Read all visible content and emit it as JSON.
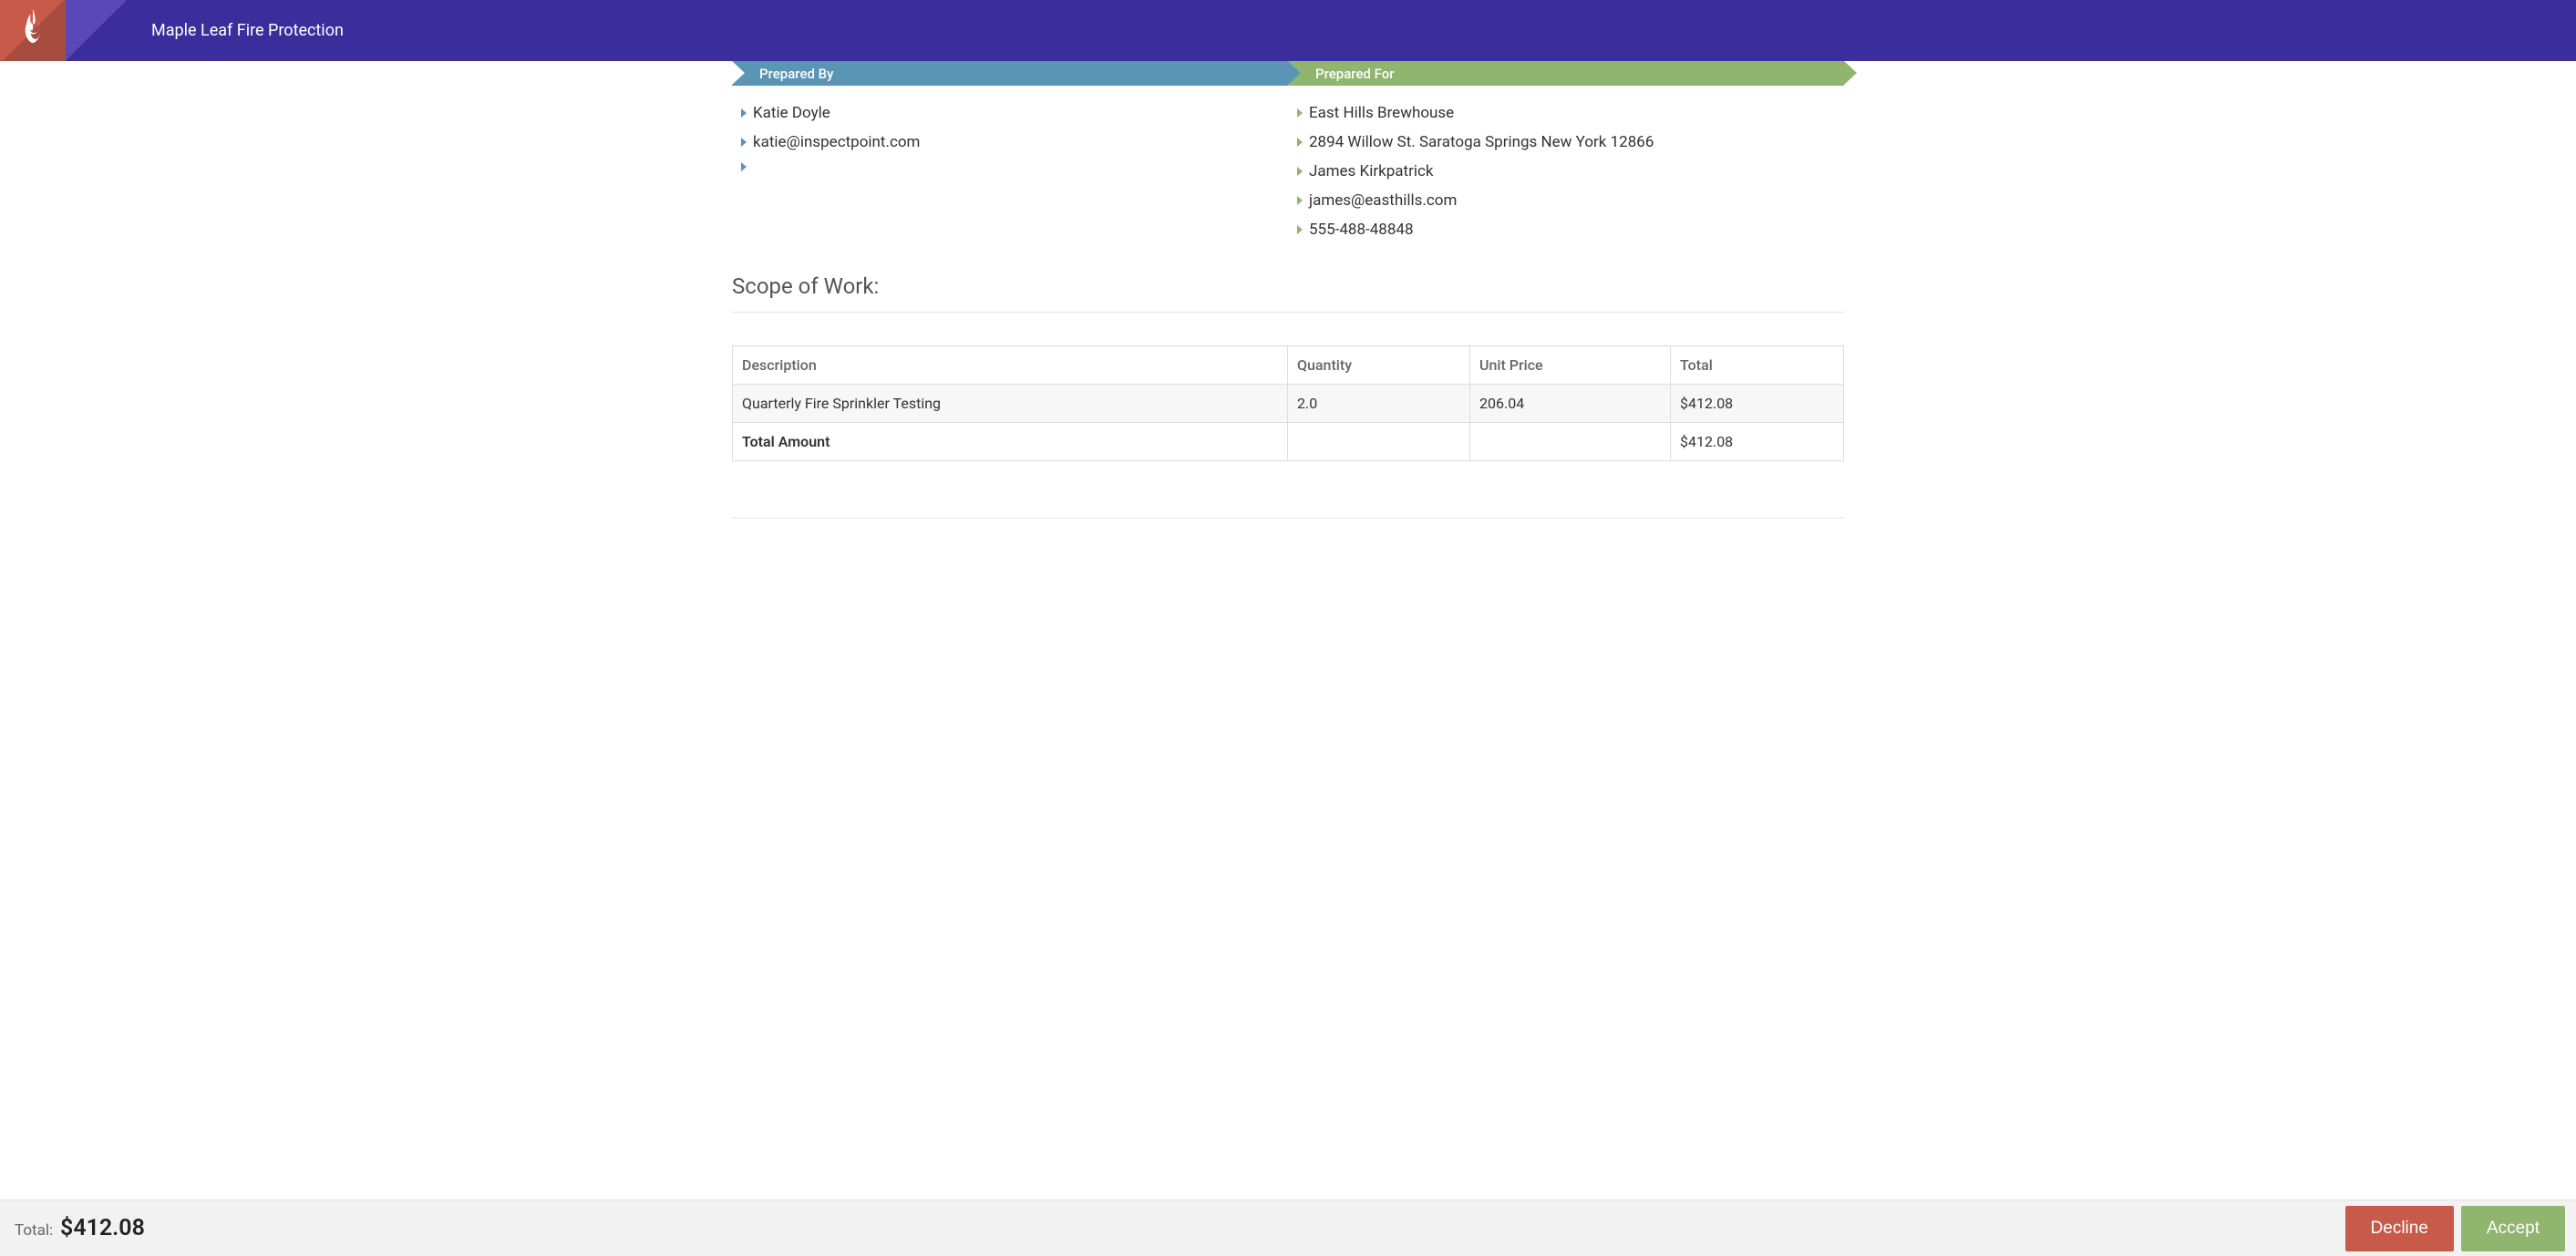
{
  "header": {
    "brand": "Maple Leaf Fire Protection"
  },
  "prepared_by": {
    "title": "Prepared By",
    "items": [
      "Katie Doyle",
      "katie@inspectpoint.com",
      ""
    ]
  },
  "prepared_for": {
    "title": "Prepared For",
    "items": [
      "East Hills Brewhouse",
      "2894 Willow St. Saratoga Springs New York 12866",
      "James Kirkpatrick",
      "james@easthills.com",
      "555-488-48848"
    ]
  },
  "scope_title": "Scope of Work:",
  "table": {
    "headers": [
      "Description",
      "Quantity",
      "Unit Price",
      "Total"
    ],
    "rows": [
      {
        "desc": "Quarterly Fire Sprinkler Testing",
        "qty": "2.0",
        "unit": "206.04",
        "total": "$412.08"
      }
    ],
    "total_row": {
      "label": "Total Amount",
      "value": "$412.08"
    }
  },
  "footer": {
    "total_label": "Total:",
    "total_value": "$412.08",
    "decline": "Decline",
    "accept": "Accept"
  }
}
